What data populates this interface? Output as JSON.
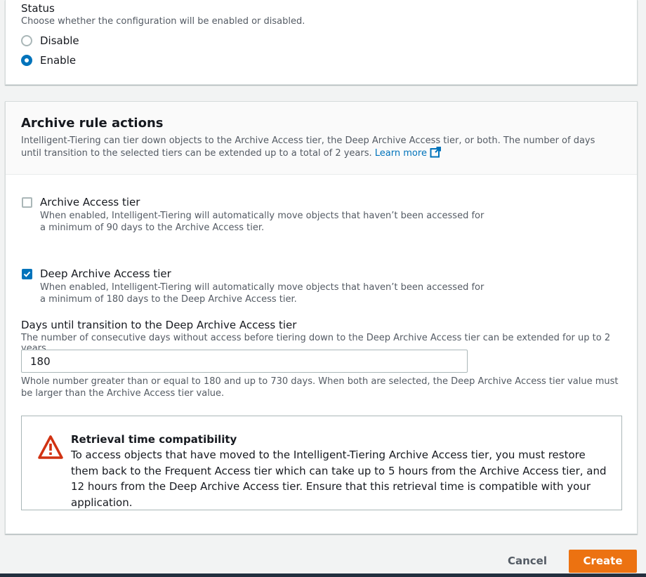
{
  "status": {
    "label": "Status",
    "description": "Choose whether the configuration will be enabled or disabled.",
    "options": [
      {
        "label": "Disable",
        "selected": false
      },
      {
        "label": "Enable",
        "selected": true
      }
    ]
  },
  "archive": {
    "title": "Archive rule actions",
    "description": "Intelligent-Tiering can tier down objects to the Archive Access tier, the Deep Archive Access tier, or both. The number of days until transition to the selected tiers can be extended up to a total of 2 years.",
    "learn_more": "Learn more",
    "tiers": [
      {
        "label": "Archive Access tier",
        "checked": false,
        "description": "When enabled, Intelligent-Tiering will automatically move objects that haven’t been accessed for a minimum of 90 days to the Archive Access tier."
      },
      {
        "label": "Deep Archive Access tier",
        "checked": true,
        "description": "When enabled, Intelligent-Tiering will automatically move objects that haven’t been accessed for a minimum of 180 days to the Deep Archive Access tier."
      }
    ],
    "days_field": {
      "label": "Days until transition to the Deep Archive Access tier",
      "description": "The number of consecutive days without access before tiering down to the Deep Archive Access tier can be extended for up to 2 years.",
      "value": "180",
      "constraint": "Whole number greater than or equal to 180 and up to 730 days. When both are selected, the Deep Archive Access tier value must be larger than the Archive Access tier value."
    },
    "alert": {
      "icon": "warning-icon",
      "title": "Retrieval time compatibility",
      "body": "To access objects that have moved to the Intelligent-Tiering Archive Access tier, you must restore them back to the Frequent Access tier which can take up to 5 hours from the Archive Access tier, and 12 hours from the Deep Archive Access tier. Ensure that this retrieval time is compatible with your application."
    }
  },
  "footer": {
    "cancel_label": "Cancel",
    "create_label": "Create"
  },
  "colors": {
    "accent": "#0073bb",
    "primary_button": "#ec7211",
    "alert_icon": "#d13212"
  }
}
